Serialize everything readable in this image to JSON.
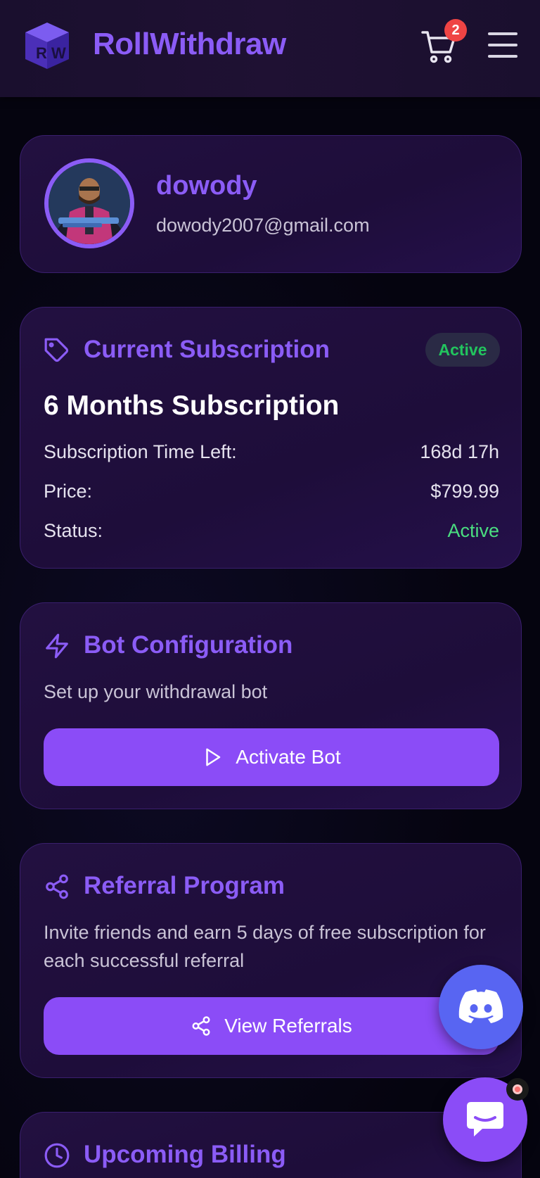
{
  "header": {
    "logo_text": "RW",
    "brand": "RollWithdraw",
    "cart_count": "2"
  },
  "profile": {
    "username": "dowody",
    "email": "dowody2007@gmail.com"
  },
  "subscription": {
    "title": "Current Subscription",
    "badge": "Active",
    "plan": "6 Months Subscription",
    "rows": [
      {
        "label": "Subscription Time Left:",
        "value": "168d 17h"
      },
      {
        "label": "Price:",
        "value": "$799.99"
      },
      {
        "label": "Status:",
        "value": "Active"
      }
    ]
  },
  "bot": {
    "title": "Bot Configuration",
    "description": "Set up your withdrawal bot",
    "button": "Activate Bot"
  },
  "referral": {
    "title": "Referral Program",
    "description": "Invite friends and earn 5 days of free subscription for each successful referral",
    "button": "View Referrals"
  },
  "billing": {
    "title": "Upcoming Billing"
  },
  "colors": {
    "accent": "#8b5cf6",
    "button": "#8b4cf7",
    "success": "#4ade80",
    "badge_red": "#ef4444",
    "discord": "#5865f2"
  },
  "icons": {
    "logo": "dice-cube-logo",
    "cart": "cart-icon",
    "menu": "hamburger-menu-icon",
    "subscription": "tag-icon",
    "bot": "lightning-icon",
    "activate": "play-icon",
    "referral": "share-icon",
    "billing": "clock-icon",
    "discord": "discord-icon",
    "chat": "chat-bubble-icon"
  }
}
